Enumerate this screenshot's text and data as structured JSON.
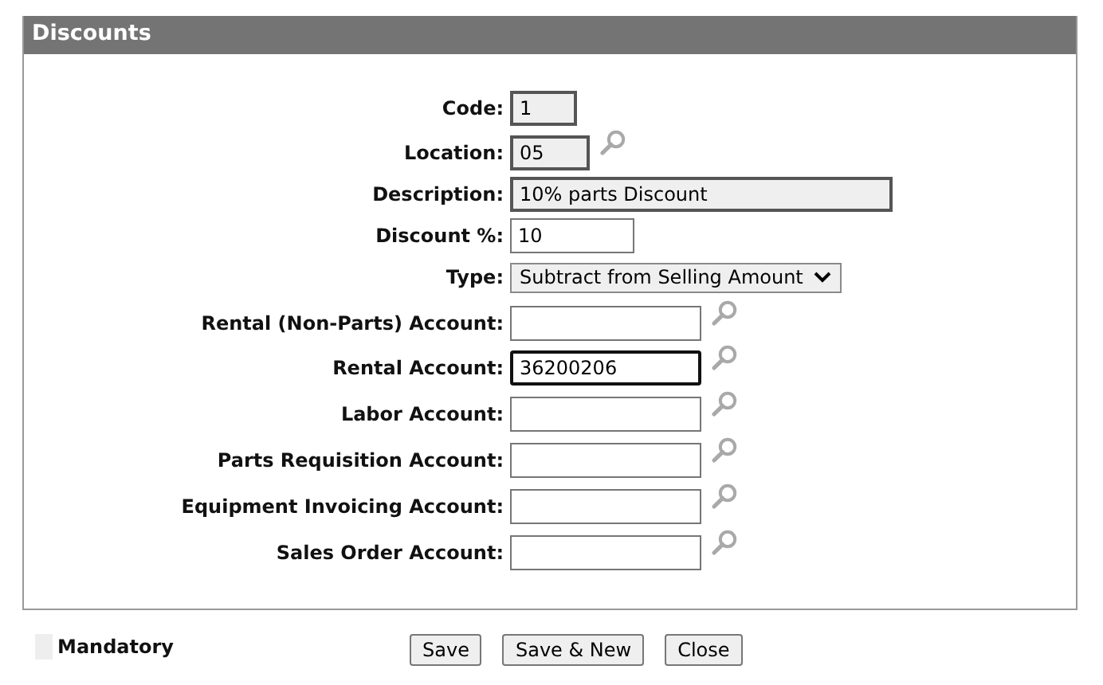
{
  "panel": {
    "title": "Discounts"
  },
  "fields": [
    {
      "label": "Code:",
      "kind": "text",
      "value": "1",
      "mandatory": true,
      "focused": false,
      "lookup": false
    },
    {
      "label": "Location:",
      "kind": "text",
      "value": "05",
      "mandatory": true,
      "focused": false,
      "lookup": true
    },
    {
      "label": "Description:",
      "kind": "text",
      "value": "10% parts Discount",
      "mandatory": true,
      "focused": false,
      "lookup": false
    },
    {
      "label": "Discount %:",
      "kind": "text",
      "value": "10",
      "mandatory": false,
      "focused": false,
      "lookup": false
    },
    {
      "label": "Type:",
      "kind": "select",
      "value": "Subtract from Selling Amount",
      "lookup": false
    },
    {
      "label": "Rental (Non-Parts) Account:",
      "kind": "text",
      "mandatory": false,
      "focused": false,
      "lookup": true
    },
    {
      "label": "Rental Account:",
      "kind": "text",
      "value": "36200206",
      "mandatory": false,
      "focused": true,
      "lookup": true
    },
    {
      "label": "Labor Account:",
      "kind": "text",
      "mandatory": false,
      "focused": false,
      "lookup": true
    },
    {
      "label": "Parts Requisition Account:",
      "kind": "text",
      "mandatory": false,
      "focused": false,
      "lookup": true
    },
    {
      "label": "Equipment Invoicing Account:",
      "kind": "text",
      "mandatory": false,
      "focused": false,
      "lookup": true
    },
    {
      "label": "Sales Order Account:",
      "kind": "text",
      "mandatory": false,
      "focused": false,
      "lookup": true
    }
  ],
  "legend": {
    "label": "Mandatory"
  },
  "buttons": [
    "Save",
    "Save & New",
    "Close"
  ]
}
